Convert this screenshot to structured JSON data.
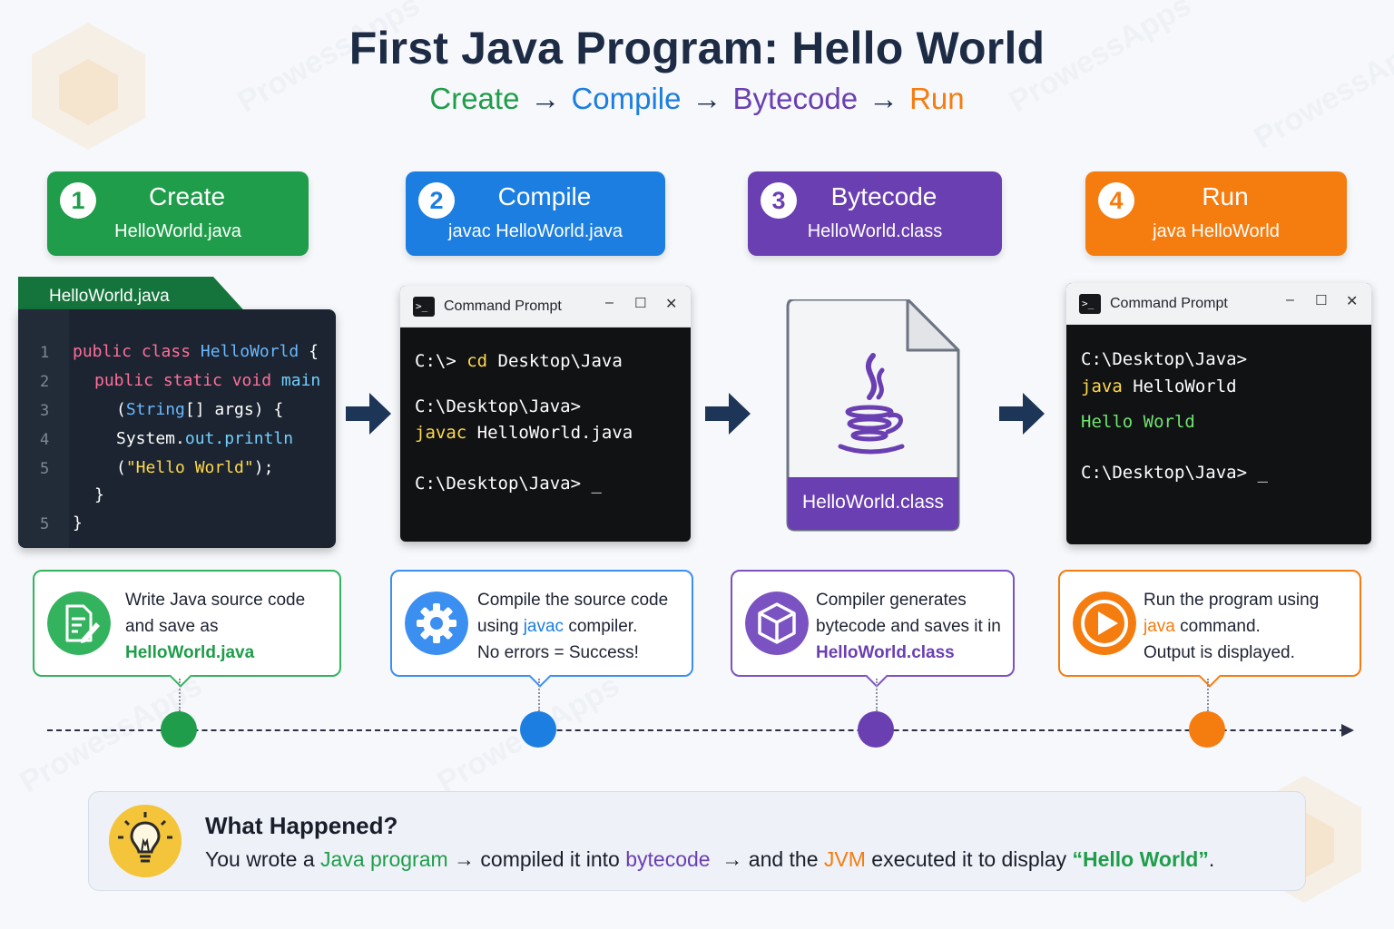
{
  "title": "First Java Program: Hello World",
  "subtitle": {
    "create": "Create",
    "compile": "Compile",
    "bytecode": "Bytecode",
    "run": "Run",
    "arrow": "→"
  },
  "colors": {
    "green": "#1f9d4a",
    "blue": "#1b7ee0",
    "purple": "#6a3fb2",
    "orange": "#f57c0f",
    "navy": "#1d2b45"
  },
  "steps": [
    {
      "num": "1",
      "name": "Create",
      "sub": "HelloWorld.java"
    },
    {
      "num": "2",
      "name": "Compile",
      "sub": "javac HelloWorld.java"
    },
    {
      "num": "3",
      "name": "Bytecode",
      "sub": "HelloWorld.class"
    },
    {
      "num": "4",
      "name": "Run",
      "sub": "java HelloWorld"
    }
  ],
  "editor": {
    "tab": "HelloWorld.java",
    "line_numbers": [
      "1",
      "2",
      "3",
      "4",
      "5",
      "5"
    ],
    "code": {
      "l1_kw": "public class ",
      "l1_cls": "HelloWorld",
      "l1_end": " {",
      "l2_kw": "public static void ",
      "l2_fn": "main",
      "l3_open": "(",
      "l3_cls": "String",
      "l3_end": "[] args) {",
      "l4_sys": "System",
      "l4_dot": ".",
      "l4_fn": "out.println",
      "l5_open": "(",
      "l5_str": "\"Hello World\"",
      "l5_end": ");",
      "l6": "}",
      "l7": "}"
    }
  },
  "terminal1": {
    "title": "Command Prompt",
    "controls": [
      "–",
      "☐",
      "✕"
    ],
    "line1_prompt": "C:\\> ",
    "line1_cmd": "cd",
    "line1_arg": " Desktop\\Java",
    "line2": "C:\\Desktop\\Java>",
    "line3_cmd": "javac",
    "line3_arg": " HelloWorld.java",
    "line4": "C:\\Desktop\\Java> _"
  },
  "classfile": {
    "label": "HelloWorld.class",
    "icon": "java-coffee-cup-icon"
  },
  "terminal2": {
    "title": "Command Prompt",
    "controls": [
      "–",
      "☐",
      "✕"
    ],
    "line1": "C:\\Desktop\\Java>",
    "line2_cmd": "java",
    "line2_arg": " HelloWorld",
    "line3": "Hello World",
    "line4": "C:\\Desktop\\Java> _"
  },
  "cards": [
    {
      "line1": "Write Java source code",
      "line2": "and save as",
      "line3": "HelloWorld.java",
      "icon": "edit-document-icon"
    },
    {
      "line1": "Compile the source code",
      "line2a": "using ",
      "line2b": "javac",
      "line2c": " compiler.",
      "line3": "No errors = Success!",
      "icon": "gear-icon"
    },
    {
      "line1": "Compiler generates",
      "line2": "bytecode and saves it in",
      "line3": "HelloWorld.class",
      "icon": "cube-icon"
    },
    {
      "line1": "Run the program using",
      "line2a": "java",
      "line2b": " command.",
      "line3": "Output is displayed.",
      "icon": "play-icon"
    }
  ],
  "summary": {
    "heading": "What Happened?",
    "p1": "You wrote a ",
    "p2": "Java program",
    "p3": " → compiled it into ",
    "p4": "bytecode",
    "p5": "  → and the ",
    "p6": "JVM",
    "p7": " executed it to display ",
    "p8": "“Hello World”",
    "p9": ".",
    "icon": "lightbulb-icon"
  },
  "watermark": "ProwessApps"
}
